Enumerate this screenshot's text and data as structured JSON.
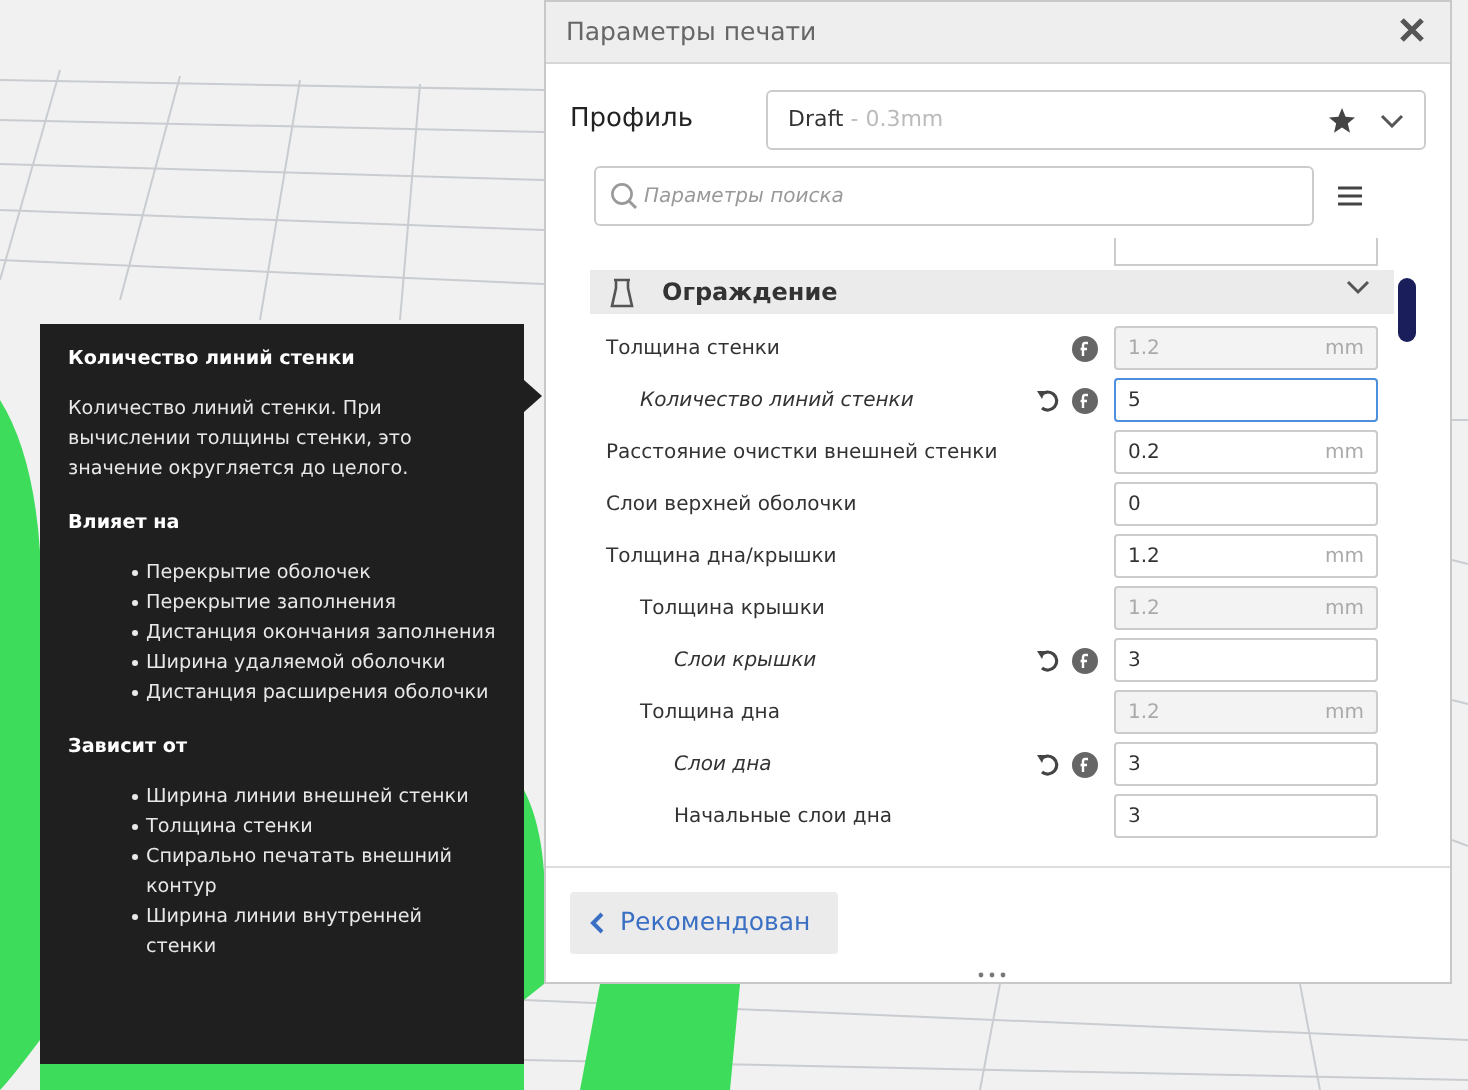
{
  "panel": {
    "title": "Параметры печати",
    "profile": {
      "label": "Профиль",
      "name": "Draft",
      "detail": " - 0.3mm"
    },
    "search": {
      "placeholder": "Параметры поиска"
    },
    "section": {
      "title": "Ограждение",
      "expanded": true
    },
    "settings": [
      {
        "label": "Толщина стенки",
        "value": "1.2",
        "unit": "mm",
        "overridden": false,
        "formula": true,
        "disabled": true,
        "focused": false,
        "children": [
          {
            "label": "Количество линий стенки",
            "value": "5",
            "overridden": true,
            "formula": true,
            "disabled": false,
            "focused": true
          }
        ]
      },
      {
        "label": "Расстояние очистки внешней стенки",
        "value": "0.2",
        "unit": "mm",
        "overridden": false,
        "formula": false,
        "disabled": false,
        "focused": false
      },
      {
        "label": "Слои верхней оболочки",
        "value": "0",
        "overridden": false,
        "formula": false,
        "disabled": false,
        "focused": false
      },
      {
        "label": "Толщина дна/крышки",
        "value": "1.2",
        "unit": "mm",
        "overridden": false,
        "formula": false,
        "disabled": false,
        "focused": false,
        "children": [
          {
            "label": "Толщина крышки",
            "value": "1.2",
            "unit": "mm",
            "overridden": false,
            "formula": false,
            "disabled": true,
            "focused": false,
            "children": [
              {
                "label": "Слои крышки",
                "value": "3",
                "overridden": true,
                "formula": true,
                "disabled": false,
                "focused": false
              }
            ]
          },
          {
            "label": "Толщина дна",
            "value": "1.2",
            "unit": "mm",
            "overridden": false,
            "formula": false,
            "disabled": true,
            "focused": false,
            "children": [
              {
                "label": "Слои дна",
                "value": "3",
                "overridden": true,
                "formula": true,
                "disabled": false,
                "focused": false
              },
              {
                "label": "Начальные слои дна",
                "value": "3",
                "overridden": false,
                "formula": false,
                "disabled": false,
                "focused": false
              }
            ]
          }
        ]
      }
    ],
    "back_button": "Рекомендован"
  },
  "tooltip": {
    "title": "Количество линий стенки",
    "description": "Количество линий стенки. При вычислении толщины стенки, это значение округляется до целого.",
    "sections": [
      {
        "heading": "Влияет на",
        "items": [
          "Перекрытие оболочек",
          "Перекрытие заполнения",
          "Дистанция окончания заполнения",
          "Ширина удаляемой оболочки",
          "Дистанция расширения оболочки"
        ]
      },
      {
        "heading": "Зависит от",
        "items": [
          "Ширина линии внешней стенки",
          "Толщина стенки",
          "Спирально печатать внешний контур",
          "Ширина линии внутренней стенки"
        ]
      }
    ]
  }
}
